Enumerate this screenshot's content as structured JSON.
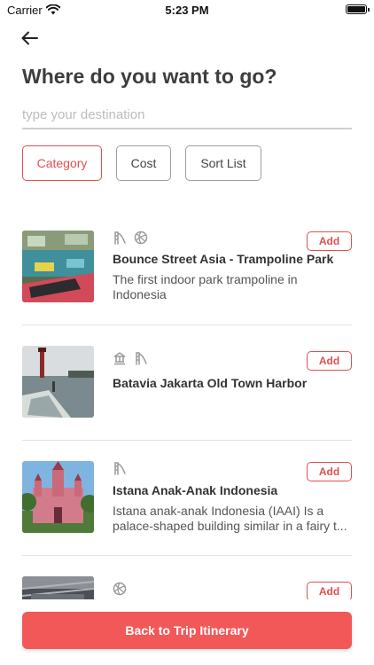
{
  "status_bar": {
    "carrier": "Carrier",
    "time": "5:23 PM"
  },
  "header": {
    "back_icon": "arrow-left-icon",
    "title": "Where do you want to go?"
  },
  "search": {
    "placeholder": "type your destination",
    "value": ""
  },
  "filters": [
    {
      "label": "Category",
      "active": true
    },
    {
      "label": "Cost",
      "active": false
    },
    {
      "label": "Sort List",
      "active": false
    }
  ],
  "places": [
    {
      "name": "Bounce Street Asia - Trampoline Park",
      "description": "The first indoor park trampoline in Indonesia",
      "category_icons": [
        "playground-slide-icon",
        "basketball-icon"
      ],
      "add_label": "Add"
    },
    {
      "name": "Batavia Jakarta Old Town Harbor",
      "description": "",
      "category_icons": [
        "monument-icon",
        "playground-slide-icon"
      ],
      "add_label": "Add"
    },
    {
      "name": "Istana Anak-Anak Indonesia",
      "description": "Istana anak-anak Indonesia (IAAI) Is a palace-shaped building similar in a fairy t...",
      "category_icons": [
        "playground-slide-icon"
      ],
      "add_label": "Add"
    },
    {
      "name": "",
      "description": "",
      "category_icons": [
        "basketball-icon"
      ],
      "add_label": "Add"
    }
  ],
  "cta": {
    "label": "Back to Trip Itinerary"
  },
  "colors": {
    "accent": "#f25858",
    "accent_border": "#e24f4f",
    "text": "#3d3d3d"
  }
}
